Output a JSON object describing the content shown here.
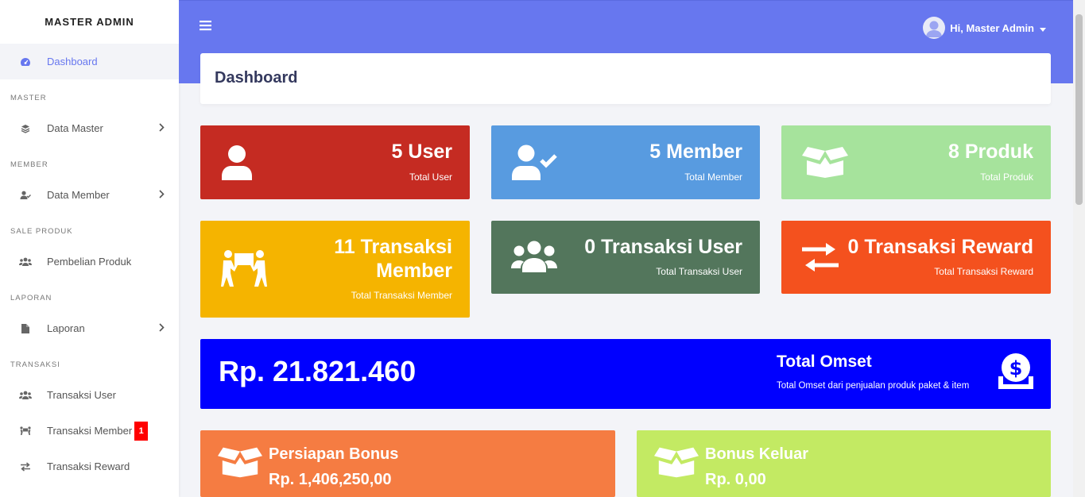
{
  "brand": "MASTER ADMIN",
  "sidebar": {
    "dashboard": "Dashboard",
    "sections": {
      "master": "MASTER",
      "member": "MEMBER",
      "sale": "SALE PRODUK",
      "laporan": "LAPORAN",
      "transaksi": "TRANSAKSI"
    },
    "items": {
      "data_master": "Data Master",
      "data_member": "Data Member",
      "pembelian_produk": "Pembelian Produk",
      "laporan": "Laporan",
      "transaksi_user": "Transaksi User",
      "transaksi_member": "Transaksi Member",
      "transaksi_member_badge": "1",
      "transaksi_reward": "Transaksi Reward"
    }
  },
  "topbar": {
    "user_greeting": "Hi, Master Admin"
  },
  "page_title": "Dashboard",
  "stats": [
    {
      "value": "5 User",
      "label": "Total User",
      "color": "#c52b22",
      "icon": "user-icon"
    },
    {
      "value": "5 Member",
      "label": "Total Member",
      "color": "#589be0",
      "icon": "user-check-icon"
    },
    {
      "value": "8 Produk",
      "label": "Total Produk",
      "color": "#a6e39c",
      "icon": "box-open-icon"
    },
    {
      "value_line1": "11 Transaksi",
      "value_line2": "Member",
      "label": "Total Transaksi Member",
      "color": "#f5b400",
      "icon": "people-carry-icon"
    },
    {
      "value": "0 Transaksi User",
      "label": "Total Transaksi User",
      "color": "#53765c",
      "icon": "users-icon"
    },
    {
      "value": "0 Transaksi Reward",
      "label": "Total Transaksi Reward",
      "color": "#f4511e",
      "icon": "exchange-icon"
    }
  ],
  "omset": {
    "amount": "Rp. 21.821.460",
    "title": "Total Omset",
    "subtitle": "Total Omset dari penjualan produk paket & item",
    "color": "#0000ff"
  },
  "bonus": [
    {
      "title": "Persiapan Bonus",
      "value": "Rp. 1,406,250,00",
      "color": "#f57c42"
    },
    {
      "title": "Bonus Keluar",
      "value": "Rp. 0,00",
      "color": "#c3ea63"
    }
  ]
}
